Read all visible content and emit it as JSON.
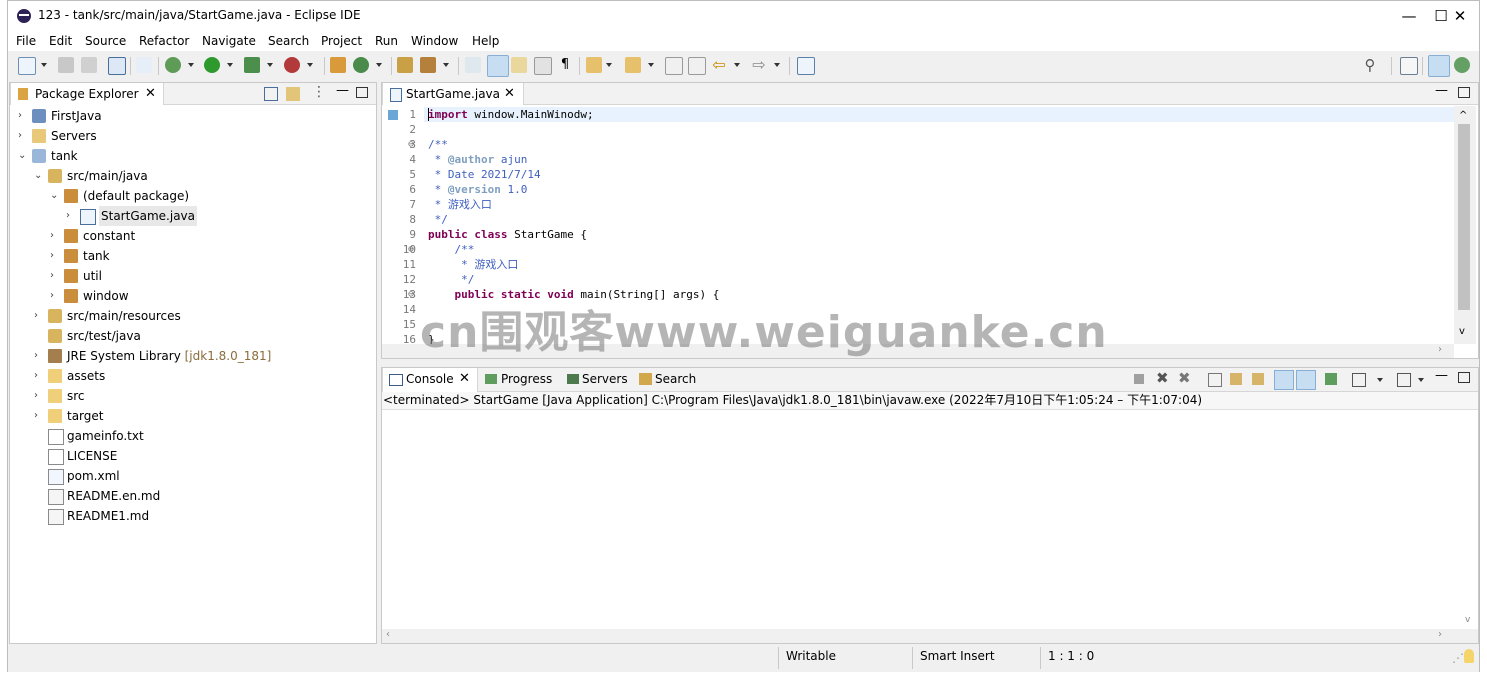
{
  "window": {
    "title": "123 - tank/src/main/java/StartGame.java - Eclipse IDE",
    "controls": {
      "minimize": "—",
      "maximize": "☐",
      "close": "✕"
    }
  },
  "menu": [
    "File",
    "Edit",
    "Source",
    "Refactor",
    "Navigate",
    "Search",
    "Project",
    "Run",
    "Window",
    "Help"
  ],
  "explorer": {
    "title": "Package Explorer",
    "items": [
      {
        "label": "FirstJava",
        "suffix": "",
        "icon": "project-icon",
        "arrow": "›",
        "depth": 0
      },
      {
        "label": "Servers",
        "suffix": "",
        "icon": "folder-project-icon",
        "arrow": "›",
        "depth": 0
      },
      {
        "label": "tank",
        "suffix": "",
        "icon": "maven-project-icon",
        "arrow": "⌄",
        "depth": 0
      },
      {
        "label": "src/main/java",
        "suffix": "",
        "icon": "source-folder-icon",
        "arrow": "⌄",
        "depth": 1
      },
      {
        "label": "(default package)",
        "suffix": "",
        "icon": "package-icon",
        "arrow": "⌄",
        "depth": 2
      },
      {
        "label": "StartGame.java",
        "suffix": "",
        "icon": "java-file-icon",
        "arrow": "›",
        "depth": 3,
        "selected": true
      },
      {
        "label": "constant",
        "suffix": "",
        "icon": "package-icon",
        "arrow": "›",
        "depth": 2
      },
      {
        "label": "tank",
        "suffix": "",
        "icon": "package-icon",
        "arrow": "›",
        "depth": 2
      },
      {
        "label": "util",
        "suffix": "",
        "icon": "package-icon",
        "arrow": "›",
        "depth": 2
      },
      {
        "label": "window",
        "suffix": "",
        "icon": "package-icon",
        "arrow": "›",
        "depth": 2
      },
      {
        "label": "src/main/resources",
        "suffix": "",
        "icon": "source-folder-icon",
        "arrow": "›",
        "depth": 1
      },
      {
        "label": "src/test/java",
        "suffix": "",
        "icon": "source-folder-icon",
        "arrow": "",
        "depth": 1
      },
      {
        "label": "JRE System Library ",
        "suffix": "[jdk1.8.0_181]",
        "icon": "library-icon",
        "arrow": "›",
        "depth": 1
      },
      {
        "label": "assets",
        "suffix": "",
        "icon": "folder-icon",
        "arrow": "›",
        "depth": 1
      },
      {
        "label": "src",
        "suffix": "",
        "icon": "folder-icon",
        "arrow": "›",
        "depth": 1
      },
      {
        "label": "target",
        "suffix": "",
        "icon": "folder-icon",
        "arrow": "›",
        "depth": 1
      },
      {
        "label": "gameinfo.txt",
        "suffix": "",
        "icon": "text-file-icon",
        "arrow": "",
        "depth": 1
      },
      {
        "label": "LICENSE",
        "suffix": "",
        "icon": "text-file-icon",
        "arrow": "",
        "depth": 1
      },
      {
        "label": "pom.xml",
        "suffix": "",
        "icon": "xml-file-icon",
        "arrow": "",
        "depth": 1
      },
      {
        "label": "README.en.md",
        "suffix": "",
        "icon": "markdown-file-icon",
        "arrow": "",
        "depth": 1
      },
      {
        "label": "README1.md",
        "suffix": "",
        "icon": "markdown-file-icon",
        "arrow": "",
        "depth": 1
      }
    ]
  },
  "editor": {
    "tab": "StartGame.java",
    "lines": [
      {
        "n": "1",
        "fold": "",
        "parts": [
          {
            "t": "import",
            "c": "kw"
          },
          {
            "t": " window.MainWinodw;",
            "c": ""
          }
        ]
      },
      {
        "n": "2",
        "fold": "",
        "parts": []
      },
      {
        "n": "3",
        "fold": "⊖",
        "parts": [
          {
            "t": "/**",
            "c": "cm"
          }
        ]
      },
      {
        "n": "4",
        "fold": "",
        "parts": [
          {
            "t": " * ",
            "c": "cm"
          },
          {
            "t": "@author",
            "c": "tag"
          },
          {
            "t": " ajun",
            "c": "cm"
          }
        ]
      },
      {
        "n": "5",
        "fold": "",
        "parts": [
          {
            "t": " * Date 2021/7/14",
            "c": "cm"
          }
        ]
      },
      {
        "n": "6",
        "fold": "",
        "parts": [
          {
            "t": " * ",
            "c": "cm"
          },
          {
            "t": "@version",
            "c": "tag"
          },
          {
            "t": " 1.0",
            "c": "cm"
          }
        ]
      },
      {
        "n": "7",
        "fold": "",
        "parts": [
          {
            "t": " * 游戏入口",
            "c": "cm"
          }
        ]
      },
      {
        "n": "8",
        "fold": "",
        "parts": [
          {
            "t": " */",
            "c": "cm"
          }
        ]
      },
      {
        "n": "9",
        "fold": "",
        "parts": [
          {
            "t": "public class",
            "c": "kw"
          },
          {
            "t": " StartGame {",
            "c": ""
          }
        ]
      },
      {
        "n": "10",
        "fold": "⊖",
        "parts": [
          {
            "t": "    /**",
            "c": "cm"
          }
        ]
      },
      {
        "n": "11",
        "fold": "",
        "parts": [
          {
            "t": "     * 游戏入口",
            "c": "cm"
          }
        ]
      },
      {
        "n": "12",
        "fold": "",
        "parts": [
          {
            "t": "     */",
            "c": "cm"
          }
        ]
      },
      {
        "n": "13",
        "fold": "⊖",
        "parts": [
          {
            "t": "    public static void",
            "c": "kw"
          },
          {
            "t": " main(String[] args) {",
            "c": ""
          }
        ]
      },
      {
        "n": "14",
        "fold": "",
        "parts": []
      },
      {
        "n": "15",
        "fold": "",
        "parts": []
      },
      {
        "n": "16",
        "fold": "",
        "parts": [
          {
            "t": "}",
            "c": ""
          }
        ]
      }
    ]
  },
  "console": {
    "tabs": [
      "Console",
      "Progress",
      "Servers",
      "Search"
    ],
    "status": "<terminated> StartGame [Java Application] C:\\Program Files\\Java\\jdk1.8.0_181\\bin\\javaw.exe  (2022年7月10日下午1:05:24 – 下午1:07:04)"
  },
  "statusbar": {
    "writable": "Writable",
    "insert_mode": "Smart Insert",
    "position": "1 : 1 : 0"
  },
  "watermark": "cn围观客www.weiguanke.cn",
  "colors": {
    "keyword": "#7f0055",
    "comment": "#3f5fbf",
    "javadoc_tag": "#7f9fbf",
    "selection": "#e8e8e8"
  }
}
